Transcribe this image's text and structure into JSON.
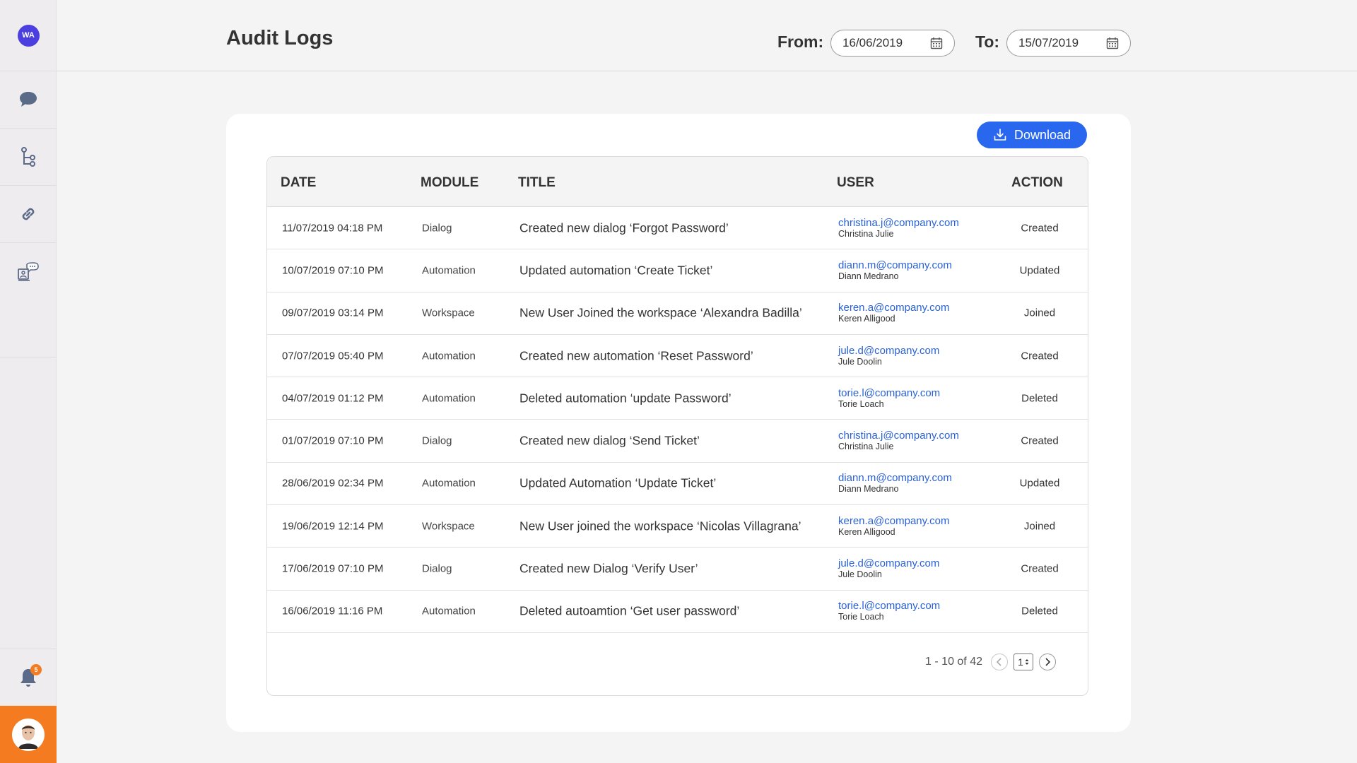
{
  "sidebar": {
    "logo": "WA",
    "icons": [
      "chat-icon",
      "flow-icon",
      "link-icon",
      "bot-icon"
    ],
    "notifications_count": "5"
  },
  "header": {
    "title": "Audit Logs",
    "from_label": "From:",
    "from_value": "16/06/2019",
    "to_label": "To:",
    "to_value": "15/07/2019"
  },
  "toolbar": {
    "download_label": "Download"
  },
  "table": {
    "columns": [
      "DATE",
      "MODULE",
      "TITLE",
      "USER",
      "ACTION"
    ],
    "rows": [
      {
        "date": "11/07/2019 04:18 PM",
        "module": "Dialog",
        "title": "Created new dialog ‘Forgot Password’",
        "email": "christina.j@company.com",
        "name": "Christina Julie",
        "action": "Created"
      },
      {
        "date": "10/07/2019 07:10 PM",
        "module": "Automation",
        "title": "Updated automation ‘Create Ticket’",
        "email": "diann.m@company.com",
        "name": "Diann Medrano",
        "action": "Updated"
      },
      {
        "date": "09/07/2019 03:14 PM",
        "module": "Workspace",
        "title": "New User Joined the workspace ‘Alexandra Badilla’",
        "email": "keren.a@company.com",
        "name": "Keren Alligood",
        "action": "Joined"
      },
      {
        "date": "07/07/2019 05:40 PM",
        "module": "Automation",
        "title": "Created new automation  ‘Reset Password’",
        "email": "jule.d@company.com",
        "name": "Jule Doolin",
        "action": "Created"
      },
      {
        "date": "04/07/2019 01:12 PM",
        "module": "Automation",
        "title": "Deleted automation ‘update Password’",
        "email": "torie.l@company.com",
        "name": "Torie Loach",
        "action": "Deleted"
      },
      {
        "date": "01/07/2019 07:10 PM",
        "module": "Dialog",
        "title": "Created new dialog  ‘Send Ticket’",
        "email": "christina.j@company.com",
        "name": "Christina Julie",
        "action": "Created"
      },
      {
        "date": "28/06/2019 02:34 PM",
        "module": "Automation",
        "title": "Updated Automation ‘Update Ticket’",
        "email": "diann.m@company.com",
        "name": "Diann Medrano",
        "action": "Updated"
      },
      {
        "date": "19/06/2019 12:14 PM",
        "module": "Workspace",
        "title": "New User joined the workspace ‘Nicolas Villagrana’",
        "email": "keren.a@company.com",
        "name": "Keren Alligood",
        "action": "Joined"
      },
      {
        "date": "17/06/2019 07:10 PM",
        "module": "Dialog",
        "title": "Created new Dialog ‘Verify User’",
        "email": "jule.d@company.com",
        "name": "Jule Doolin",
        "action": "Created"
      },
      {
        "date": "16/06/2019 11:16 PM",
        "module": "Automation",
        "title": "Deleted autoamtion  ‘Get user password’",
        "email": "torie.l@company.com",
        "name": "Torie Loach",
        "action": "Deleted"
      }
    ]
  },
  "pagination": {
    "range_text": "1 - 10 of 42",
    "current_page": "1"
  },
  "colors": {
    "accent": "#2967ee",
    "brand_orange": "#f47b20",
    "logo": "#4b3fe0"
  }
}
